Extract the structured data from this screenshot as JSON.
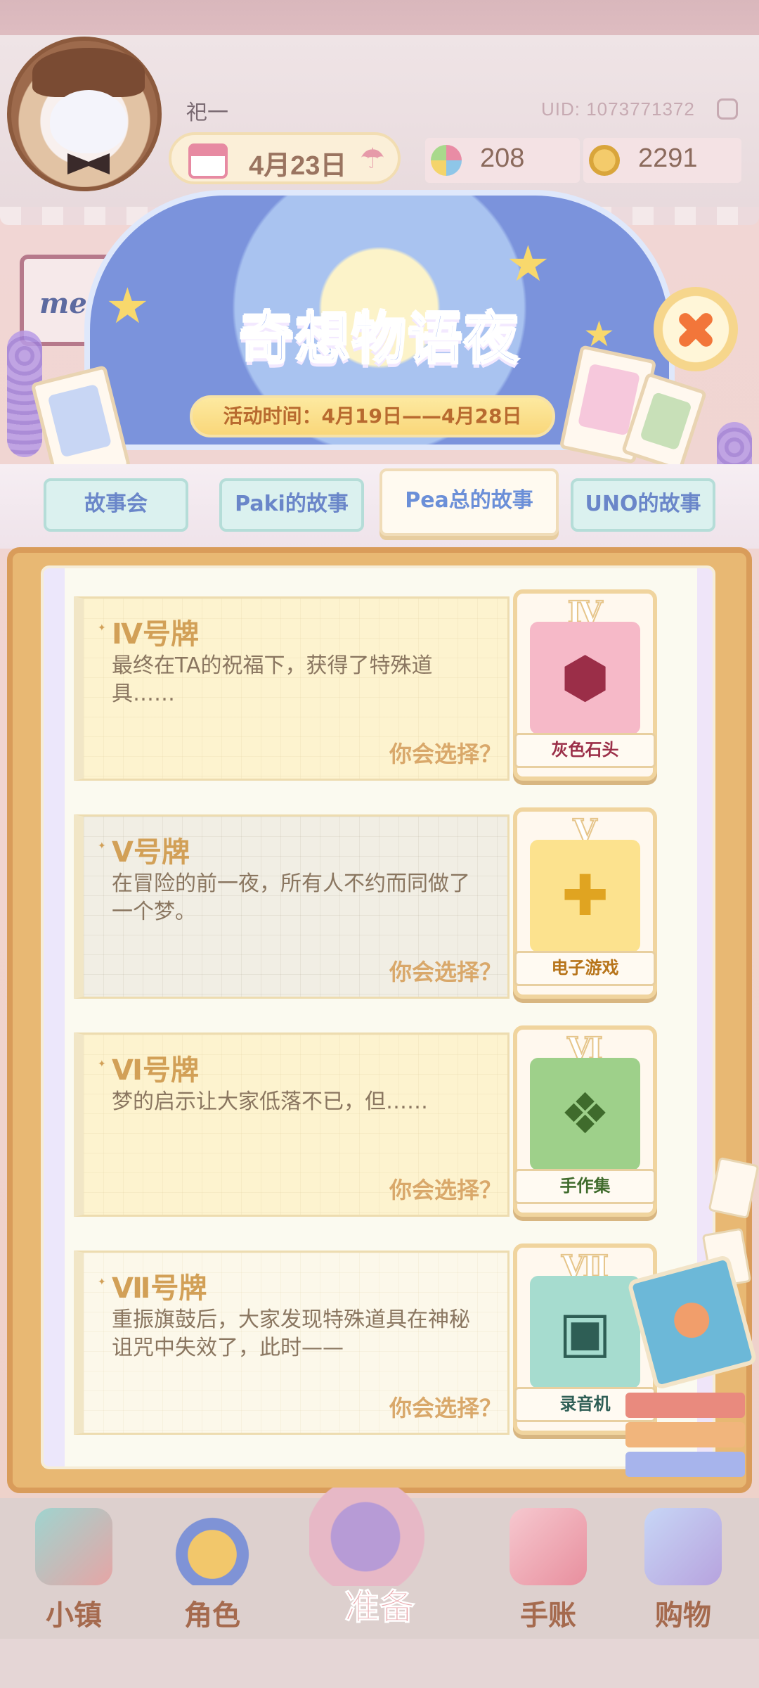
{
  "header": {
    "player_name": "祀一",
    "uid": "UID: 1073771372",
    "date": "4月23日",
    "gems": "208",
    "coins": "2291"
  },
  "menu": {
    "label": "menu"
  },
  "event": {
    "title": "奇想物语夜",
    "time": "活动时间：4月19日——4月28日"
  },
  "tabs": [
    {
      "label": "故事会",
      "active": false
    },
    {
      "label": "Paki的故事",
      "active": false
    },
    {
      "label": "Pea总的故事",
      "active": true
    },
    {
      "label": "UNO的故事",
      "active": false
    }
  ],
  "stories": [
    {
      "title": "Ⅳ号牌",
      "desc": "最终在TA的祝福下，获得了特殊道具……",
      "choose": "你会选择？",
      "card_numeral": "Ⅳ",
      "card_name": "灰色石头",
      "card_icon": "crystal-rock-icon",
      "card_color": "#f6b9c8",
      "card_text_color": "#9b2e48"
    },
    {
      "title": "Ⅴ号牌",
      "desc": "在冒险的前一夜，所有人不约而同做了一个梦。",
      "choose": "你会选择？",
      "card_numeral": "Ⅴ",
      "card_name": "电子游戏",
      "card_icon": "game-controller-icon",
      "card_color": "#fce28e",
      "card_text_color": "#b7741a"
    },
    {
      "title": "Ⅵ号牌",
      "desc": "梦的启示让大家低落不已，但……",
      "choose": "你会选择？",
      "card_numeral": "Ⅵ",
      "card_name": "手作集",
      "card_icon": "open-book-icon",
      "card_color": "#9ed08a",
      "card_text_color": "#3f6b2c"
    },
    {
      "title": "Ⅶ号牌",
      "desc": "重振旗鼓后，大家发现特殊道具在神秘诅咒中失效了，此时——",
      "choose": "你会选择？",
      "card_numeral": "Ⅶ",
      "card_name": "录音机",
      "card_icon": "radio-recorder-icon",
      "card_color": "#a6dccf",
      "card_text_color": "#2e5e55"
    }
  ],
  "bottom_nav": [
    {
      "label": "小镇",
      "icon": "town-map-icon"
    },
    {
      "label": "角色",
      "icon": "character-icon"
    },
    {
      "label": "准备",
      "icon": "prepare-bag-icon"
    },
    {
      "label": "手账",
      "icon": "journal-icon"
    },
    {
      "label": "购物",
      "icon": "shopping-bag-icon"
    }
  ],
  "colors": {
    "accent_gold": "#d2a057",
    "tab_text": "#6a86c9",
    "nav_text": "#a56a4e"
  }
}
